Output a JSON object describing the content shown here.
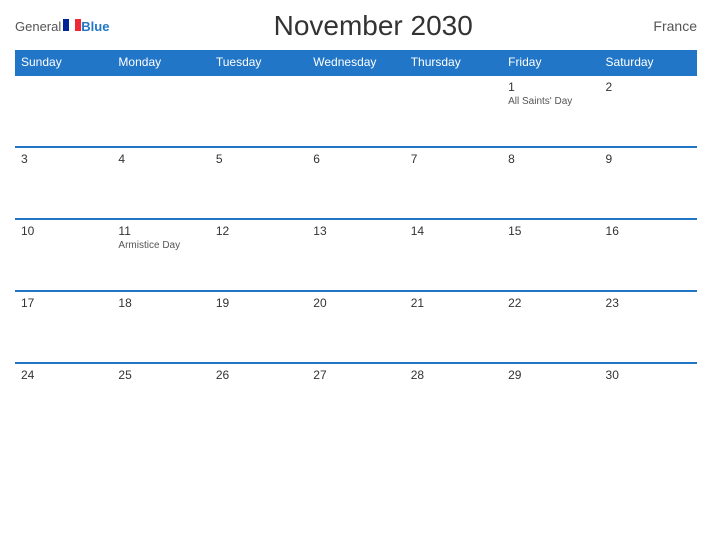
{
  "header": {
    "title": "November 2030",
    "country": "France",
    "logo_general": "General",
    "logo_blue": "Blue"
  },
  "weekdays": [
    {
      "label": "Sunday"
    },
    {
      "label": "Monday"
    },
    {
      "label": "Tuesday"
    },
    {
      "label": "Wednesday"
    },
    {
      "label": "Thursday"
    },
    {
      "label": "Friday"
    },
    {
      "label": "Saturday"
    }
  ],
  "weeks": [
    {
      "days": [
        {
          "number": "",
          "holiday": "",
          "empty": true
        },
        {
          "number": "",
          "holiday": "",
          "empty": true
        },
        {
          "number": "",
          "holiday": "",
          "empty": true
        },
        {
          "number": "",
          "holiday": "",
          "empty": true
        },
        {
          "number": "",
          "holiday": "",
          "empty": true
        },
        {
          "number": "1",
          "holiday": "All Saints' Day",
          "empty": false
        },
        {
          "number": "2",
          "holiday": "",
          "empty": false
        }
      ]
    },
    {
      "days": [
        {
          "number": "3",
          "holiday": "",
          "empty": false
        },
        {
          "number": "4",
          "holiday": "",
          "empty": false
        },
        {
          "number": "5",
          "holiday": "",
          "empty": false
        },
        {
          "number": "6",
          "holiday": "",
          "empty": false
        },
        {
          "number": "7",
          "holiday": "",
          "empty": false
        },
        {
          "number": "8",
          "holiday": "",
          "empty": false
        },
        {
          "number": "9",
          "holiday": "",
          "empty": false
        }
      ]
    },
    {
      "days": [
        {
          "number": "10",
          "holiday": "",
          "empty": false
        },
        {
          "number": "11",
          "holiday": "Armistice Day",
          "empty": false
        },
        {
          "number": "12",
          "holiday": "",
          "empty": false
        },
        {
          "number": "13",
          "holiday": "",
          "empty": false
        },
        {
          "number": "14",
          "holiday": "",
          "empty": false
        },
        {
          "number": "15",
          "holiday": "",
          "empty": false
        },
        {
          "number": "16",
          "holiday": "",
          "empty": false
        }
      ]
    },
    {
      "days": [
        {
          "number": "17",
          "holiday": "",
          "empty": false
        },
        {
          "number": "18",
          "holiday": "",
          "empty": false
        },
        {
          "number": "19",
          "holiday": "",
          "empty": false
        },
        {
          "number": "20",
          "holiday": "",
          "empty": false
        },
        {
          "number": "21",
          "holiday": "",
          "empty": false
        },
        {
          "number": "22",
          "holiday": "",
          "empty": false
        },
        {
          "number": "23",
          "holiday": "",
          "empty": false
        }
      ]
    },
    {
      "days": [
        {
          "number": "24",
          "holiday": "",
          "empty": false
        },
        {
          "number": "25",
          "holiday": "",
          "empty": false
        },
        {
          "number": "26",
          "holiday": "",
          "empty": false
        },
        {
          "number": "27",
          "holiday": "",
          "empty": false
        },
        {
          "number": "28",
          "holiday": "",
          "empty": false
        },
        {
          "number": "29",
          "holiday": "",
          "empty": false
        },
        {
          "number": "30",
          "holiday": "",
          "empty": false
        }
      ]
    }
  ]
}
